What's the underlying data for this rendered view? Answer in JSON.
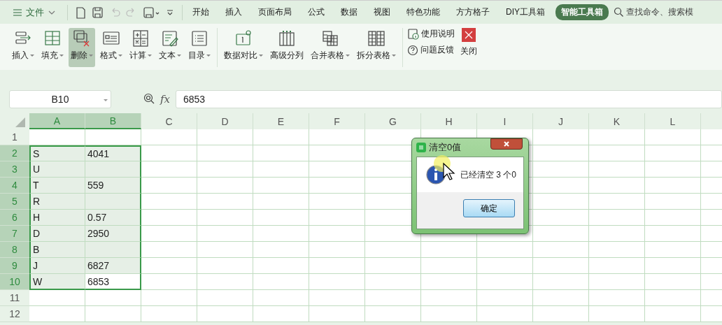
{
  "menubar": {
    "file_menu": "文件",
    "quick_access": [
      {
        "kind": "new",
        "disabled": false
      },
      {
        "kind": "save",
        "disabled": false
      },
      {
        "kind": "undo",
        "disabled": true
      },
      {
        "kind": "redo",
        "disabled": true
      },
      {
        "kind": "preview",
        "disabled": false
      },
      {
        "kind": "customize",
        "disabled": false
      }
    ],
    "tabs": [
      {
        "label": "开始",
        "selected": false
      },
      {
        "label": "插入",
        "selected": false
      },
      {
        "label": "页面布局",
        "selected": false
      },
      {
        "label": "公式",
        "selected": false
      },
      {
        "label": "数据",
        "selected": false
      },
      {
        "label": "视图",
        "selected": false
      },
      {
        "label": "特色功能",
        "selected": false
      },
      {
        "label": "方方格子",
        "selected": false
      },
      {
        "label": "DIY工具箱",
        "selected": false
      },
      {
        "label": "智能工具箱",
        "selected": true
      }
    ],
    "search": {
      "placeholder": "查找命令、搜索模"
    }
  },
  "ribbon": {
    "groups": [
      {
        "items": [
          {
            "kind": "insert",
            "label": "插入",
            "dropdown": true,
            "selected": false
          },
          {
            "kind": "fill",
            "label": "填充",
            "dropdown": true,
            "selected": false
          },
          {
            "kind": "delete",
            "label": "删除",
            "dropdown": true,
            "selected": true
          },
          {
            "kind": "format",
            "label": "格式",
            "dropdown": true,
            "selected": false
          },
          {
            "kind": "calc",
            "label": "计算",
            "dropdown": true,
            "selected": false
          },
          {
            "kind": "text",
            "label": "文本",
            "dropdown": true,
            "selected": false
          },
          {
            "kind": "toc",
            "label": "目录",
            "dropdown": true,
            "selected": false
          }
        ]
      },
      {
        "items": [
          {
            "kind": "compare",
            "label": "数据对比",
            "dropdown": true,
            "selected": false
          },
          {
            "kind": "split",
            "label": "高级分列",
            "dropdown": false,
            "selected": false
          },
          {
            "kind": "merge",
            "label": "合并表格",
            "dropdown": true,
            "selected": false
          },
          {
            "kind": "splittable",
            "label": "拆分表格",
            "dropdown": true,
            "selected": false
          }
        ]
      }
    ],
    "help_links": [
      {
        "kind": "info",
        "label": "使用说明"
      },
      {
        "kind": "question",
        "label": "问题反馈"
      }
    ],
    "close_button": "关闭"
  },
  "formula_bar": {
    "name_box": "B10",
    "function_label": "fx",
    "value": "6853"
  },
  "sheet": {
    "columns": [
      {
        "label": "A",
        "selected": true
      },
      {
        "label": "B",
        "selected": true
      },
      {
        "label": "C",
        "selected": false
      },
      {
        "label": "D",
        "selected": false
      },
      {
        "label": "E",
        "selected": false
      },
      {
        "label": "F",
        "selected": false
      },
      {
        "label": "G",
        "selected": false
      },
      {
        "label": "H",
        "selected": false
      },
      {
        "label": "I",
        "selected": false
      },
      {
        "label": "J",
        "selected": false
      },
      {
        "label": "K",
        "selected": false
      },
      {
        "label": "L",
        "selected": false
      }
    ],
    "rows": [
      {
        "number": "1",
        "selected": false,
        "cells": []
      },
      {
        "number": "2",
        "selected": true,
        "cells": [
          "S",
          "4041"
        ]
      },
      {
        "number": "3",
        "selected": true,
        "cells": [
          "U"
        ]
      },
      {
        "number": "4",
        "selected": true,
        "cells": [
          "T",
          "559"
        ]
      },
      {
        "number": "5",
        "selected": true,
        "cells": [
          "R"
        ]
      },
      {
        "number": "6",
        "selected": true,
        "cells": [
          "H",
          "0.57"
        ]
      },
      {
        "number": "7",
        "selected": true,
        "cells": [
          "D",
          "2950"
        ]
      },
      {
        "number": "8",
        "selected": true,
        "cells": [
          "B"
        ]
      },
      {
        "number": "9",
        "selected": true,
        "cells": [
          "J",
          "6827"
        ]
      },
      {
        "number": "10",
        "selected": true,
        "cells": [
          "W",
          "6853"
        ]
      },
      {
        "number": "11",
        "selected": false,
        "cells": []
      },
      {
        "number": "12",
        "selected": false,
        "cells": []
      }
    ]
  },
  "dialog": {
    "title": "清空0值",
    "message": "已经清空 3 个0",
    "button": "确定"
  }
}
